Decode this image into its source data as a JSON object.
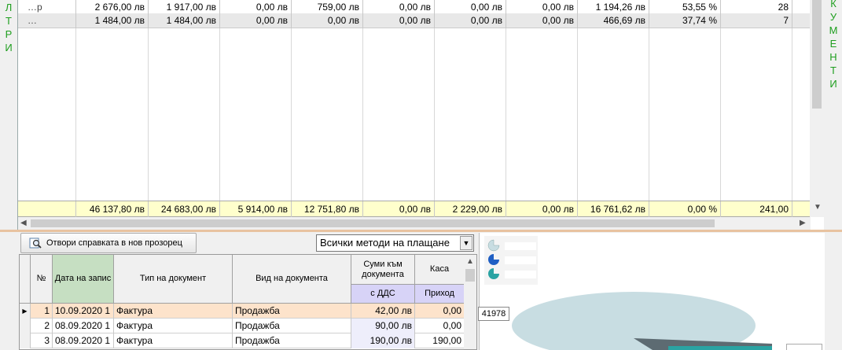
{
  "left_side_label": [
    "Л",
    "Т",
    "Р",
    "И"
  ],
  "right_side_label": [
    "К",
    "У",
    "М",
    "Е",
    "Н",
    "Т",
    "И"
  ],
  "upper_grid": {
    "rows": [
      {
        "name": "…р",
        "cells": [
          "2 676,00 лв",
          "1 917,00 лв",
          "0,00 лв",
          "759,00 лв",
          "0,00 лв",
          "0,00 лв",
          "0,00 лв",
          "1 194,26 лв",
          "53,55 %",
          "28"
        ]
      },
      {
        "name": "…",
        "cells": [
          "1 484,00 лв",
          "1 484,00 лв",
          "0,00 лв",
          "0,00 лв",
          "0,00 лв",
          "0,00 лв",
          "0,00 лв",
          "466,69 лв",
          "37,74 %",
          "7"
        ]
      }
    ],
    "totals": [
      "46 137,80 лв",
      "24 683,00 лв",
      "5 914,00 лв",
      "12 751,80 лв",
      "0,00 лв",
      "2 229,00 лв",
      "0,00 лв",
      "16 761,62 лв",
      "0,00 %",
      "241,00"
    ]
  },
  "toolbar": {
    "open_report_label": "Отвори справката в нов прозорец",
    "payment_method_value": "Всички методи на плащане"
  },
  "lower_grid": {
    "headers": {
      "num": "№",
      "date": "Дата на запис",
      "doc_type": "Тип на документ",
      "doc_kind": "Вид на документа",
      "sums": "Суми към документа",
      "sums_sub": "с ДДС",
      "cash": "Каса",
      "cash_sub": "Приход"
    },
    "rows": [
      {
        "num": "1",
        "date": "10.09.2020 1",
        "type": "Фактура",
        "kind": "Продажба",
        "sum": "42,00 лв",
        "cash": "0,00"
      },
      {
        "num": "2",
        "date": "08.09.2020 1",
        "type": "Фактура",
        "kind": "Продажба",
        "sum": "90,00 лв",
        "cash": "0,00"
      },
      {
        "num": "3",
        "date": "08.09.2020 1",
        "type": "Фактура",
        "kind": "Продажба",
        "sum": "190,00 лв",
        "cash": "190,00"
      }
    ]
  },
  "chart": {
    "tooltip_value": "41978",
    "colors": {
      "pie_main": "#c8dde2",
      "pie_dark": "#5d6b72",
      "pie_teal": "#2aa3a3",
      "legend_blue": "#1f5fc4"
    }
  }
}
